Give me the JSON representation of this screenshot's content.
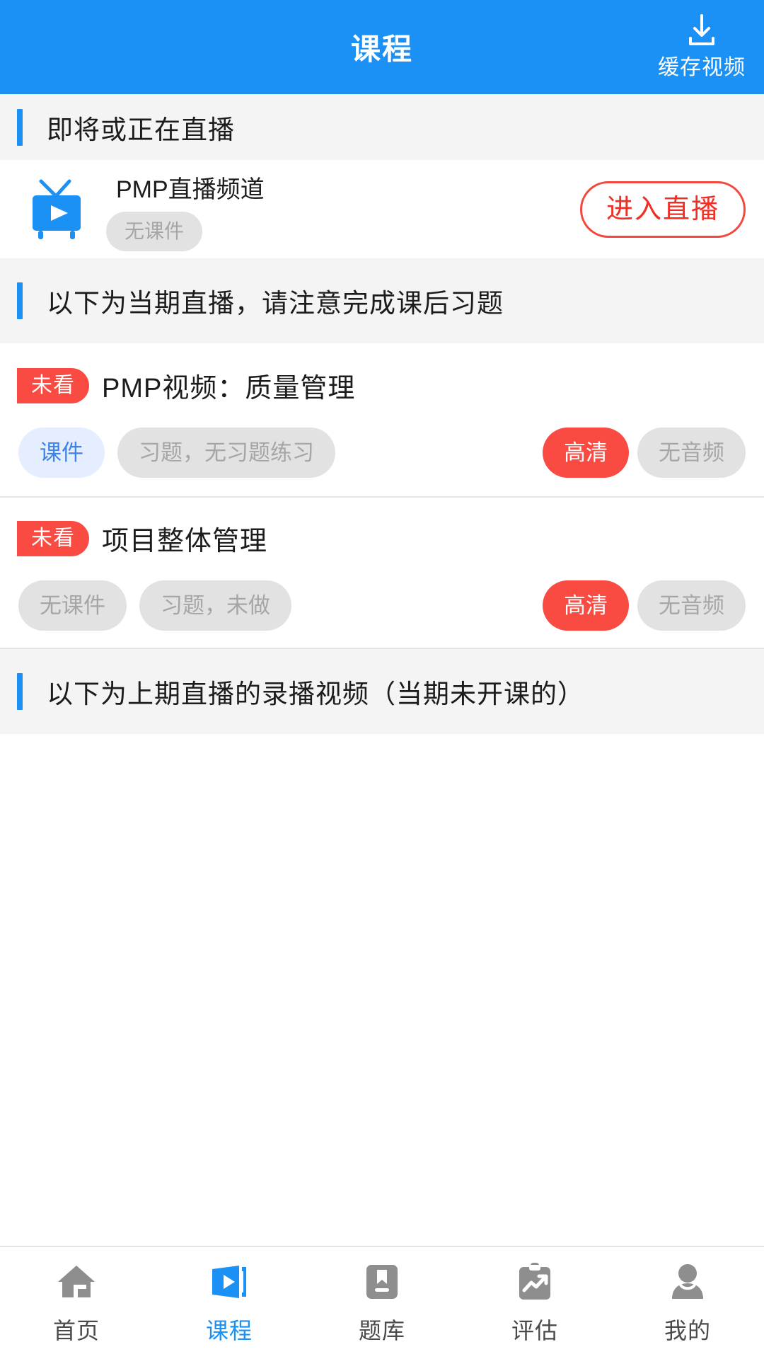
{
  "topbar": {
    "title": "课程",
    "action_label": "缓存视频",
    "action_icon": "download-icon",
    "bg_color": "#1b90f5"
  },
  "sections": [
    {
      "id": "upcoming-live",
      "title": "即将或正在直播"
    },
    {
      "id": "current-term-live",
      "title": "以下为当期直播，请注意完成课后习题"
    },
    {
      "id": "previous-term-recordings",
      "title": "以下为上期直播的录播视频（当期未开课的）"
    }
  ],
  "live_channel": {
    "icon": "tv-play-icon",
    "name": "PMP直播频道",
    "courseware_tag": "无课件",
    "enter_button": "进入直播",
    "enter_button_color": "#ef2e24"
  },
  "videos": [
    {
      "badge": "未看",
      "title": "PMP视频：质量管理",
      "tags_left": [
        {
          "label": "课件",
          "style": "blue"
        },
        {
          "label": "习题，无习题练习",
          "style": "gray"
        }
      ],
      "tags_right": [
        {
          "label": "高清",
          "style": "red"
        },
        {
          "label": "无音频",
          "style": "gray"
        }
      ]
    },
    {
      "badge": "未看",
      "title": "项目整体管理",
      "tags_left": [
        {
          "label": "无课件",
          "style": "gray"
        },
        {
          "label": "习题，未做",
          "style": "gray"
        }
      ],
      "tags_right": [
        {
          "label": "高清",
          "style": "red"
        },
        {
          "label": "无音频",
          "style": "gray"
        }
      ]
    }
  ],
  "bottom_nav": {
    "active_index": 1,
    "active_color": "#1b90f5",
    "items": [
      {
        "label": "首页",
        "icon": "home-icon"
      },
      {
        "label": "课程",
        "icon": "video-play-icon"
      },
      {
        "label": "题库",
        "icon": "bookmark-book-icon"
      },
      {
        "label": "评估",
        "icon": "clipboard-chart-icon"
      },
      {
        "label": "我的",
        "icon": "person-icon"
      }
    ]
  }
}
